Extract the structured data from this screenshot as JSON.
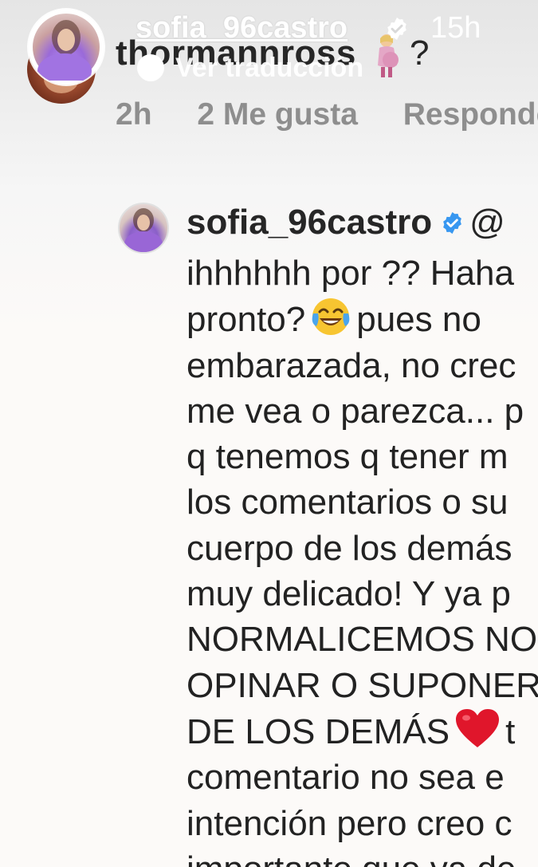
{
  "story": {
    "username": "sofia_96castro",
    "time": "15h",
    "translate_label": "Ver traducción",
    "avatar_icon": "profile-photo"
  },
  "original_comment": {
    "author": "thormannross",
    "emoji_icon": "pregnant-woman-emoji",
    "question_mark": "?",
    "age": "2h",
    "likes": "2 Me gusta",
    "reply_label": "Responder"
  },
  "reply": {
    "username": "sofia_96castro",
    "verified_icon": "verified-badge-icon",
    "mention": "@",
    "lines": [
      {
        "text": "ihhhhhh por ?? Haha"
      },
      {
        "before": "pronto?",
        "emoji": "face-with-tears-of-joy-emoji",
        "after": "pues no"
      },
      {
        "text": "embarazada, no crec"
      },
      {
        "text": "me vea o parezca... p"
      },
      {
        "text": "q tenemos q tener m"
      },
      {
        "text": "los comentarios o su"
      },
      {
        "text": "cuerpo de los demás"
      },
      {
        "text": "muy delicado! Y ya p"
      },
      {
        "text": "NORMALICEMOS NO"
      },
      {
        "text": "OPINAR O SUPONER"
      },
      {
        "before": "DE LOS DEMÁS",
        "emoji": "red-heart-emoji",
        "after": "t"
      },
      {
        "text": "comentario no sea e"
      },
      {
        "text": "intención pero creo c"
      },
      {
        "text": "importante que ya de"
      }
    ]
  },
  "colors": {
    "text_primary": "#262626",
    "text_secondary": "#8e8e8e",
    "verified_blue": "#3897f0",
    "overlay_white": "#ffffff"
  }
}
